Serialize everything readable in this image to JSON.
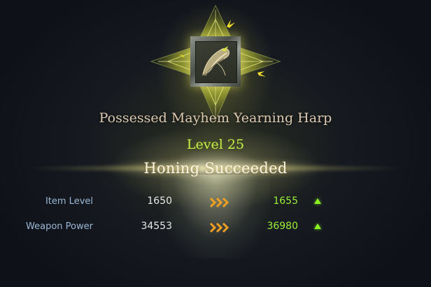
{
  "item": {
    "name": "Possessed Mayhem Yearning Harp",
    "level": "Level 25",
    "icon": "harp-weapon-icon"
  },
  "result": "Honing Succeeded",
  "stats": [
    {
      "label": "Item Level",
      "old": "1650",
      "new": "1655"
    },
    {
      "label": "Weapon Power",
      "old": "34553",
      "new": "36980"
    }
  ],
  "colors": {
    "level": "#c8f04a",
    "new_value": "#9ef03a",
    "label": "#9ab8d6",
    "arrows": "#f0a020",
    "name": "#dcc9b0"
  }
}
